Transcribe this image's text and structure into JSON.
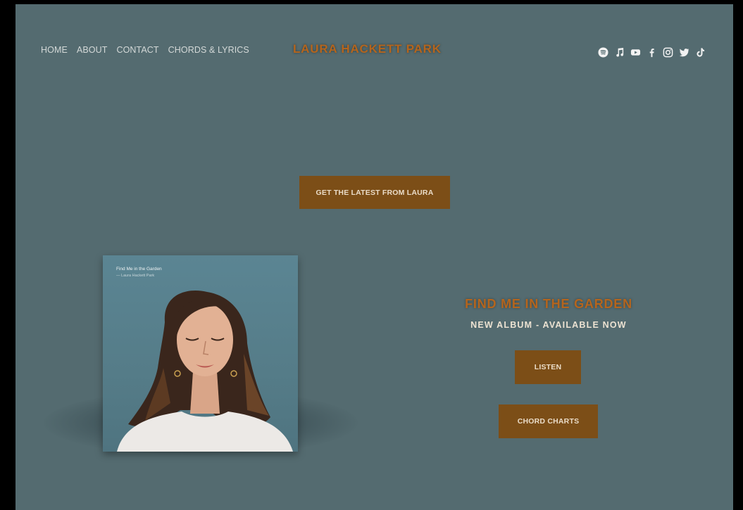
{
  "nav": {
    "items": [
      "HOME",
      "ABOUT",
      "CONTACT",
      "CHORDS & LYRICS"
    ]
  },
  "brand": {
    "name": "LAURA HACKETT PARK"
  },
  "social": {
    "icons": [
      "spotify-icon",
      "apple-music-icon",
      "youtube-icon",
      "facebook-icon",
      "instagram-icon",
      "twitter-icon",
      "tiktok-icon"
    ]
  },
  "cta": {
    "label": "GET THE LATEST FROM LAURA"
  },
  "album": {
    "cover_title": "Find Me in the Garden",
    "cover_artist": "— Laura Hackett Park"
  },
  "release": {
    "title": "FIND ME IN THE GARDEN",
    "subtitle": "NEW ALBUM - AVAILABLE NOW",
    "listen_label": "LISTEN",
    "chords_label": "CHORD CHARTS"
  },
  "colors": {
    "background": "#546b70",
    "accent": "#b5651d",
    "button": "#7c4e17"
  }
}
